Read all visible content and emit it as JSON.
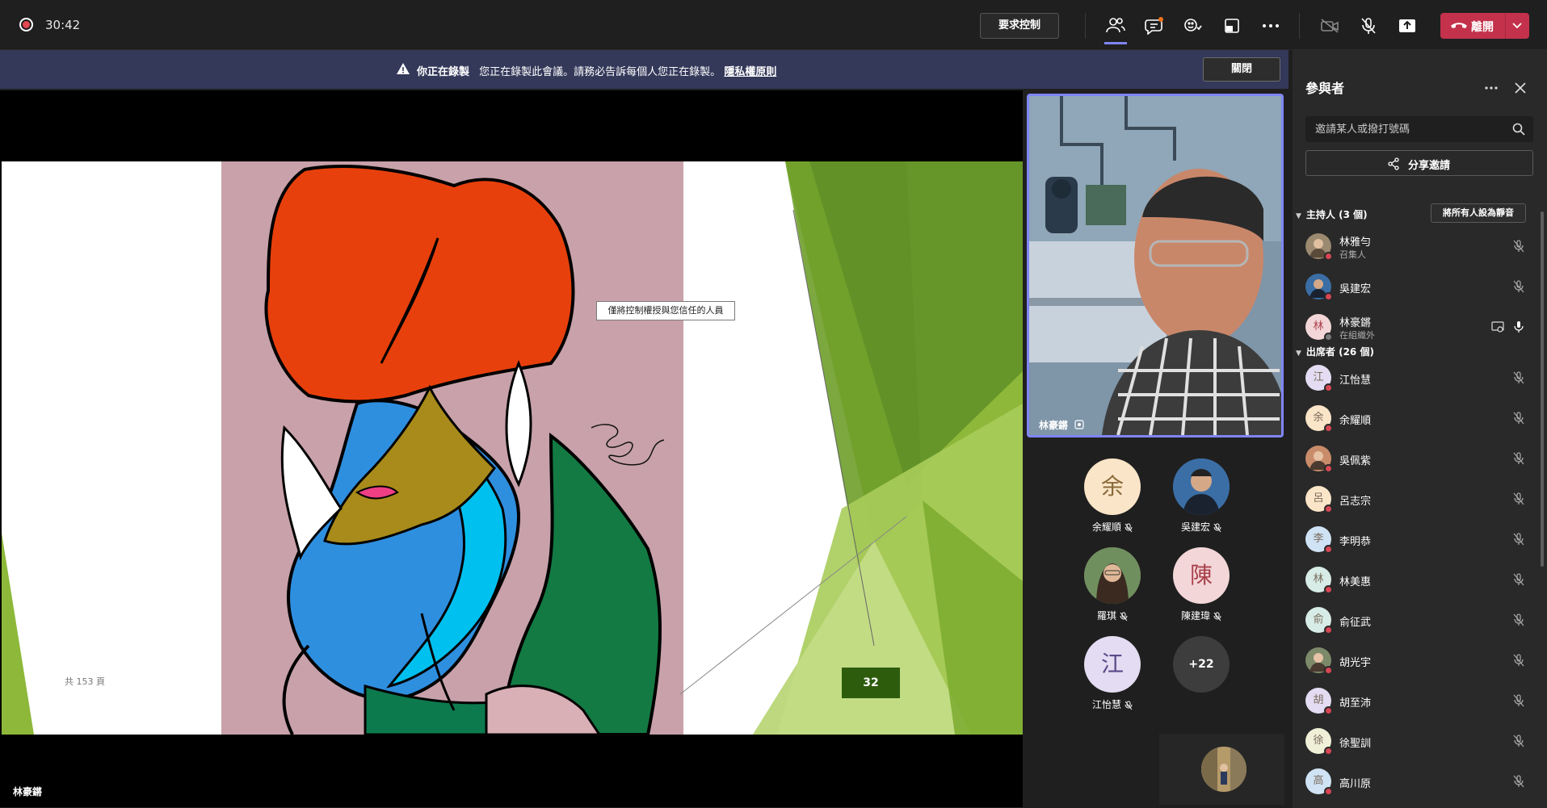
{
  "topbar": {
    "timer": "30:42",
    "request_control": "要求控制",
    "leave": "離開"
  },
  "banner": {
    "title": "你正在錄製",
    "text": "您正在錄製此會議。請務必告訴每個人您正在錄製。",
    "privacy_link": "隱私權原則",
    "close": "關閉"
  },
  "slide": {
    "page_count": "共 153 頁",
    "slide_number": "32",
    "tooltip": "僅將控制權授與您信任的人員"
  },
  "stage": {
    "presenter_name": "林豪鏘"
  },
  "main_video": {
    "name": "林豪鏘"
  },
  "tiles": [
    {
      "name": "余耀順",
      "initial": "余",
      "bg": "#fbe5c8"
    },
    {
      "name": "吳建宏",
      "initial": "",
      "bg": "#3b6ea5"
    },
    {
      "name": "羅琪",
      "initial": "",
      "bg": "#8a6b55"
    },
    {
      "name": "陳建瑋",
      "initial": "陳",
      "bg": "#f3d6d8"
    },
    {
      "name": "江怡慧",
      "initial": "江",
      "bg": "#e3dcf2"
    }
  ],
  "more_tile": "+22",
  "panel": {
    "title": "參與者",
    "search_placeholder": "邀請某人或撥打號碼",
    "share": "分享邀請",
    "mute_all": "將所有人設為靜音",
    "organizers_label": "主持人 (3 個)",
    "attendees_label": "出席者 (26 個)",
    "organizers": [
      {
        "name": "林雅勻",
        "sub": "召集人",
        "initial": "",
        "bg": "#9b8a70"
      },
      {
        "name": "吳建宏",
        "sub": "",
        "initial": "",
        "bg": "#3b6ea5"
      },
      {
        "name": "林豪鏘",
        "sub": "在組織外",
        "initial": "林",
        "bg": "#f3d6d8"
      }
    ],
    "attendees": [
      {
        "name": "江怡慧",
        "initial": "江",
        "bg": "#e3dcf2"
      },
      {
        "name": "余耀順",
        "initial": "余",
        "bg": "#fbe5c8"
      },
      {
        "name": "吳佩紫",
        "initial": "",
        "bg": "#c98c6a"
      },
      {
        "name": "呂志宗",
        "initial": "呂",
        "bg": "#fbe5c8"
      },
      {
        "name": "李明恭",
        "initial": "李",
        "bg": "#cfe3f5"
      },
      {
        "name": "林美惠",
        "initial": "林",
        "bg": "#d7ece6"
      },
      {
        "name": "俞征武",
        "initial": "俞",
        "bg": "#d7ece6"
      },
      {
        "name": "胡光宇",
        "initial": "",
        "bg": "#7d8a6a"
      },
      {
        "name": "胡至沛",
        "initial": "胡",
        "bg": "#e3dcf2"
      },
      {
        "name": "徐聖訓",
        "initial": "徐",
        "bg": "#f0efd8"
      },
      {
        "name": "高川原",
        "initial": "高",
        "bg": "#cfe3f5"
      }
    ]
  }
}
